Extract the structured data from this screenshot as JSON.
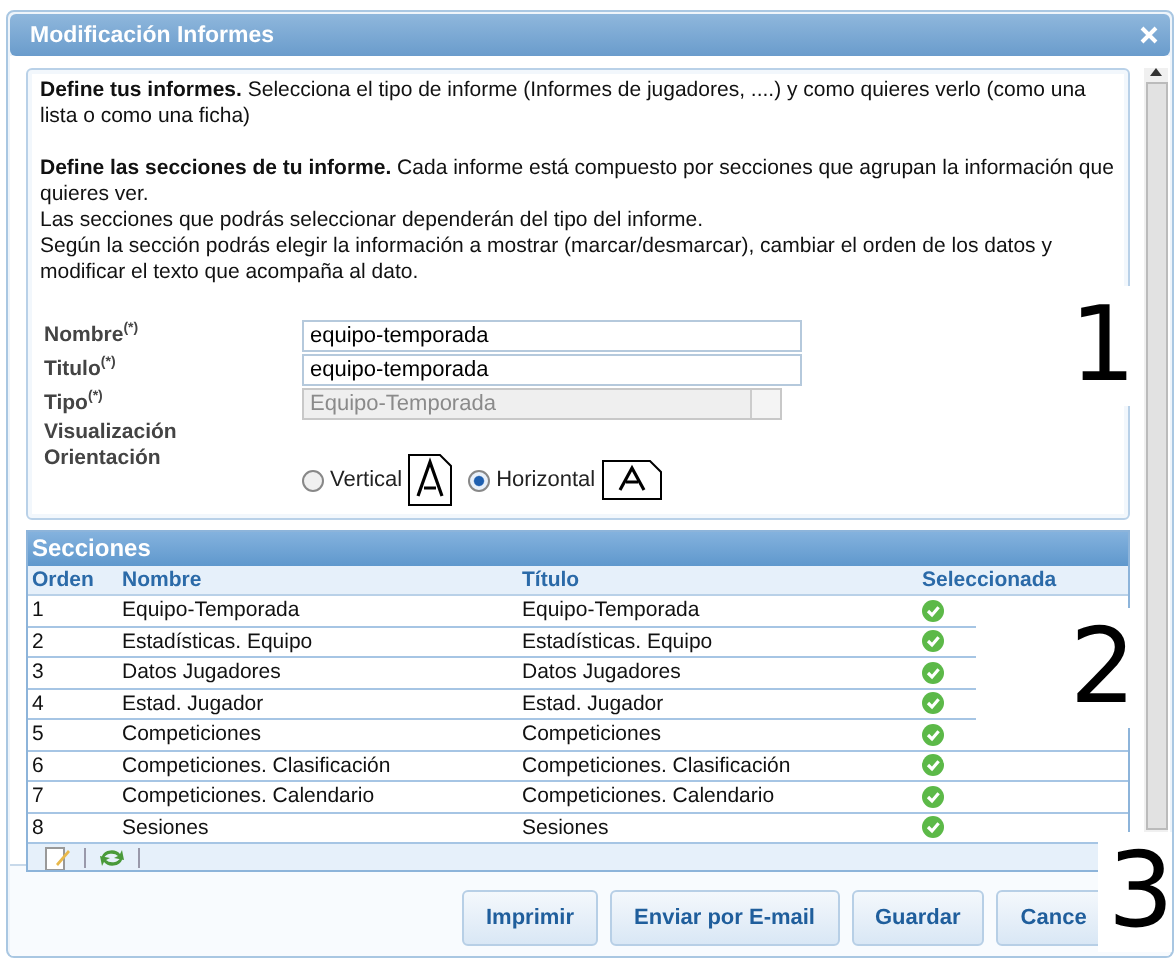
{
  "window": {
    "title": "Modificación Informes"
  },
  "intro": [
    "**Define tus informes.** Selecciona el tipo de informe (Informes de jugadores, ....) y como quieres verlo (como una lista o como una ficha)",
    "**Define las secciones de tu informe.** Cada informe está compuesto por secciones que agrupan la información que quieres ver.",
    "Las secciones que podrás seleccionar dependerán del tipo del informe.",
    "Según la sección podrás elegir la información a mostrar (marcar/desmarcar), cambiar el orden de los datos y modificar el texto que acompaña al dato."
  ],
  "form": {
    "fields": [
      {
        "label": "Nombre$^{(*)}$",
        "kind": "text",
        "value": "equipo-temporada"
      },
      {
        "label": "Titulo$^{(*)}$",
        "kind": "text",
        "value": "equipo-temporada"
      },
      {
        "label": "Tipo$^{(*)}$",
        "kind": "select",
        "value": "Equipo-Temporada",
        "disabled": true
      }
    ],
    "visualizacion": "Visualización",
    "orientacion": {
      "label": "Orientación",
      "options": [
        {
          "label": "Vertical",
          "selected": false
        },
        {
          "label": "Horizontal",
          "selected": true
        }
      ]
    }
  },
  "sections": {
    "title": "Secciones",
    "columns": [
      "Orden",
      "Nombre",
      "Título",
      "Seleccionada"
    ],
    "rows": [
      {
        "orden": "1",
        "nombre": "Equipo-Temporada",
        "titulo": "Equipo-Temporada",
        "selected": true
      },
      {
        "orden": "2",
        "nombre": "Estadísticas. Equipo",
        "titulo": "Estadísticas. Equipo",
        "selected": true
      },
      {
        "orden": "3",
        "nombre": "Datos Jugadores",
        "titulo": "Datos Jugadores",
        "selected": true
      },
      {
        "orden": "4",
        "nombre": "Estad. Jugador",
        "titulo": "Estad. Jugador",
        "selected": true
      },
      {
        "orden": "5",
        "nombre": "Competiciones",
        "titulo": "Competiciones",
        "selected": true
      },
      {
        "orden": "6",
        "nombre": "Competiciones. Clasificación",
        "titulo": "Competiciones. Clasificación",
        "selected": true
      },
      {
        "orden": "7",
        "nombre": "Competiciones. Calendario",
        "titulo": "Competiciones. Calendario",
        "selected": true
      },
      {
        "orden": "8",
        "nombre": "Sesiones",
        "titulo": "Sesiones",
        "selected": true
      }
    ]
  },
  "buttons": [
    "Imprimir",
    "Enviar por E-mail",
    "Guardar",
    "Cance"
  ],
  "callouts": [
    "1",
    "2",
    "3"
  ]
}
